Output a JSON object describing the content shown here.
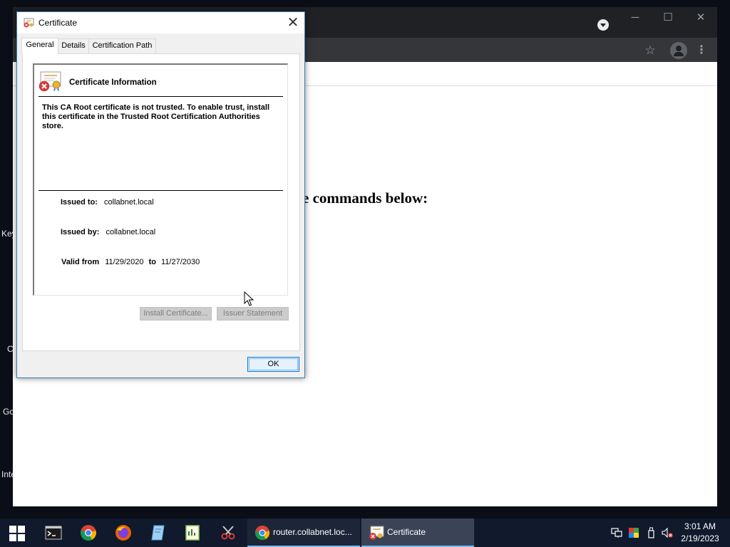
{
  "desktop": {
    "labels": [
      "Key",
      "C",
      "Go",
      "Inte"
    ]
  },
  "browser": {
    "window_controls": {
      "minimize": "─",
      "maximize": "☐",
      "close": "✕"
    },
    "page_heading": "e commands below:"
  },
  "dialog": {
    "title": "Certificate",
    "tabs": [
      "General",
      "Details",
      "Certification Path"
    ],
    "info_title": "Certificate Information",
    "trust_message": "This CA Root certificate is not trusted. To enable trust, install this certificate in the Trusted Root Certification Authorities store.",
    "issued_to_label": "Issued to:",
    "issued_to": "collabnet.local",
    "issued_by_label": "Issued by:",
    "issued_by": "collabnet.local",
    "valid_from_label": "Valid from",
    "valid_from": "11/29/2020",
    "to_label": "to",
    "valid_to": "11/27/2030",
    "install_button": "Install Certificate...",
    "issuer_button": "Issuer Statement",
    "ok_button": "OK"
  },
  "taskbar": {
    "pinned": [
      "start-icon",
      "terminal-icon",
      "chrome-icon",
      "firefox-icon",
      "notepad-icon",
      "spreadsheet-icon",
      "snipping-icon"
    ],
    "tasks": [
      {
        "label": "router.collabnet.loc...",
        "icon": "chrome-icon",
        "active": false
      },
      {
        "label": "Certificate",
        "icon": "certificate-icon",
        "active": true
      }
    ],
    "clock_time": "3:01 AM",
    "clock_date": "2/19/2023"
  },
  "colors": {
    "accent": "#0078d7",
    "taskbar": "#101a2c",
    "chrome_dark": "#202124",
    "error_red": "#d83b3b"
  }
}
